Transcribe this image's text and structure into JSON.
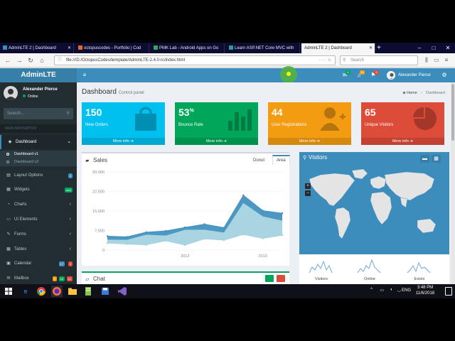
{
  "browser": {
    "tabs": [
      {
        "title": "AdminLTE 2 | Dashboard",
        "color": "#3c8dbc"
      },
      {
        "title": "octopuscodes - Portfolio | Cod",
        "color": "#e26b2c"
      },
      {
        "title": "PMK Lab - Android Apps on Go",
        "color": "#34a853"
      },
      {
        "title": "Learn ASP.NET Core MVC with",
        "color": "#2a9d8f"
      },
      {
        "title": "AdminLTE 2 | Dashboard",
        "color": "#3c8dbc"
      }
    ],
    "url": "file:///D:/OctopusCodes/template/AdminLTE-2.4.0-rc/index.html",
    "search_placeholder": "Search",
    "win_min": "–",
    "win_max": "□",
    "win_close": "✕"
  },
  "header": {
    "logo": "AdminLTE",
    "user": "Alexander Pierce",
    "messages_count": "4",
    "notifications_count": "10",
    "tasks_count": "9"
  },
  "sidebar": {
    "user_name": "Alexander Pierce",
    "status": "Online",
    "search_placeholder": "Search...",
    "section_header": "MAIN NAVIGATION",
    "items": [
      {
        "label": "Dashboard",
        "icon": "dashboard-icon"
      },
      {
        "label": "Layout Options",
        "badge": "4",
        "badge_color": "#3c8dbc"
      },
      {
        "label": "Widgets",
        "badge": "new",
        "badge_color": "#00a65a"
      },
      {
        "label": "Charts"
      },
      {
        "label": "UI Elements"
      },
      {
        "label": "Forms"
      },
      {
        "label": "Tables"
      },
      {
        "label": "Calendar",
        "badges": [
          "17",
          "3"
        ]
      },
      {
        "label": "Mailbox",
        "badges": [
          "5",
          "16",
          "12"
        ]
      }
    ],
    "sub_items": [
      "Dashboard v1",
      "Dashboard v2"
    ]
  },
  "content": {
    "title": "Dashboard",
    "subtitle": "Control panel",
    "breadcrumb": [
      "Home",
      "Dashboard"
    ],
    "boxes": [
      {
        "value": "150",
        "label": "New Orders",
        "footer": "More info",
        "color": "#00c0ef"
      },
      {
        "value": "53",
        "suffix": "%",
        "label": "Bounce Rate",
        "footer": "More info",
        "color": "#00a65a"
      },
      {
        "value": "44",
        "label": "User Registrations",
        "footer": "More info",
        "color": "#f39c12"
      },
      {
        "value": "65",
        "label": "Unique Visitors",
        "footer": "More info",
        "color": "#dd4b39"
      }
    ],
    "sales": {
      "title": "Sales",
      "tabs": [
        "Donut",
        "Area"
      ]
    },
    "visitors": {
      "title": "Visitors",
      "sparklines": [
        "Visitors",
        "Online",
        "Exists"
      ]
    },
    "chat": {
      "title": "Chat"
    }
  },
  "chart_data": {
    "type": "area",
    "x": [
      "2011 Q1",
      "2011 Q2",
      "2011 Q3",
      "2011 Q4",
      "2012 Q1",
      "2012 Q2",
      "2012 Q3",
      "2012 Q4",
      "2013 Q1",
      "2013 Q2"
    ],
    "xticks": [
      "2012",
      "2013"
    ],
    "yticks": [
      "0",
      "7,500",
      "15,000",
      "22,500",
      "30,000"
    ],
    "ylim": [
      0,
      30000
    ],
    "series": [
      {
        "color": "#a0d0e0",
        "values": [
          2666,
          2778,
          4912,
          3767,
          6810,
          5670,
          4820,
          15073,
          10687,
          8432
        ]
      },
      {
        "color": "#3c8dbc",
        "values": [
          2666,
          2294,
          1969,
          3597,
          1914,
          4293,
          3795,
          5967,
          4460,
          5713
        ]
      }
    ]
  },
  "taskbar": {
    "lang": "ENG",
    "time": "3:48 PM",
    "date": "11/6/2018"
  }
}
